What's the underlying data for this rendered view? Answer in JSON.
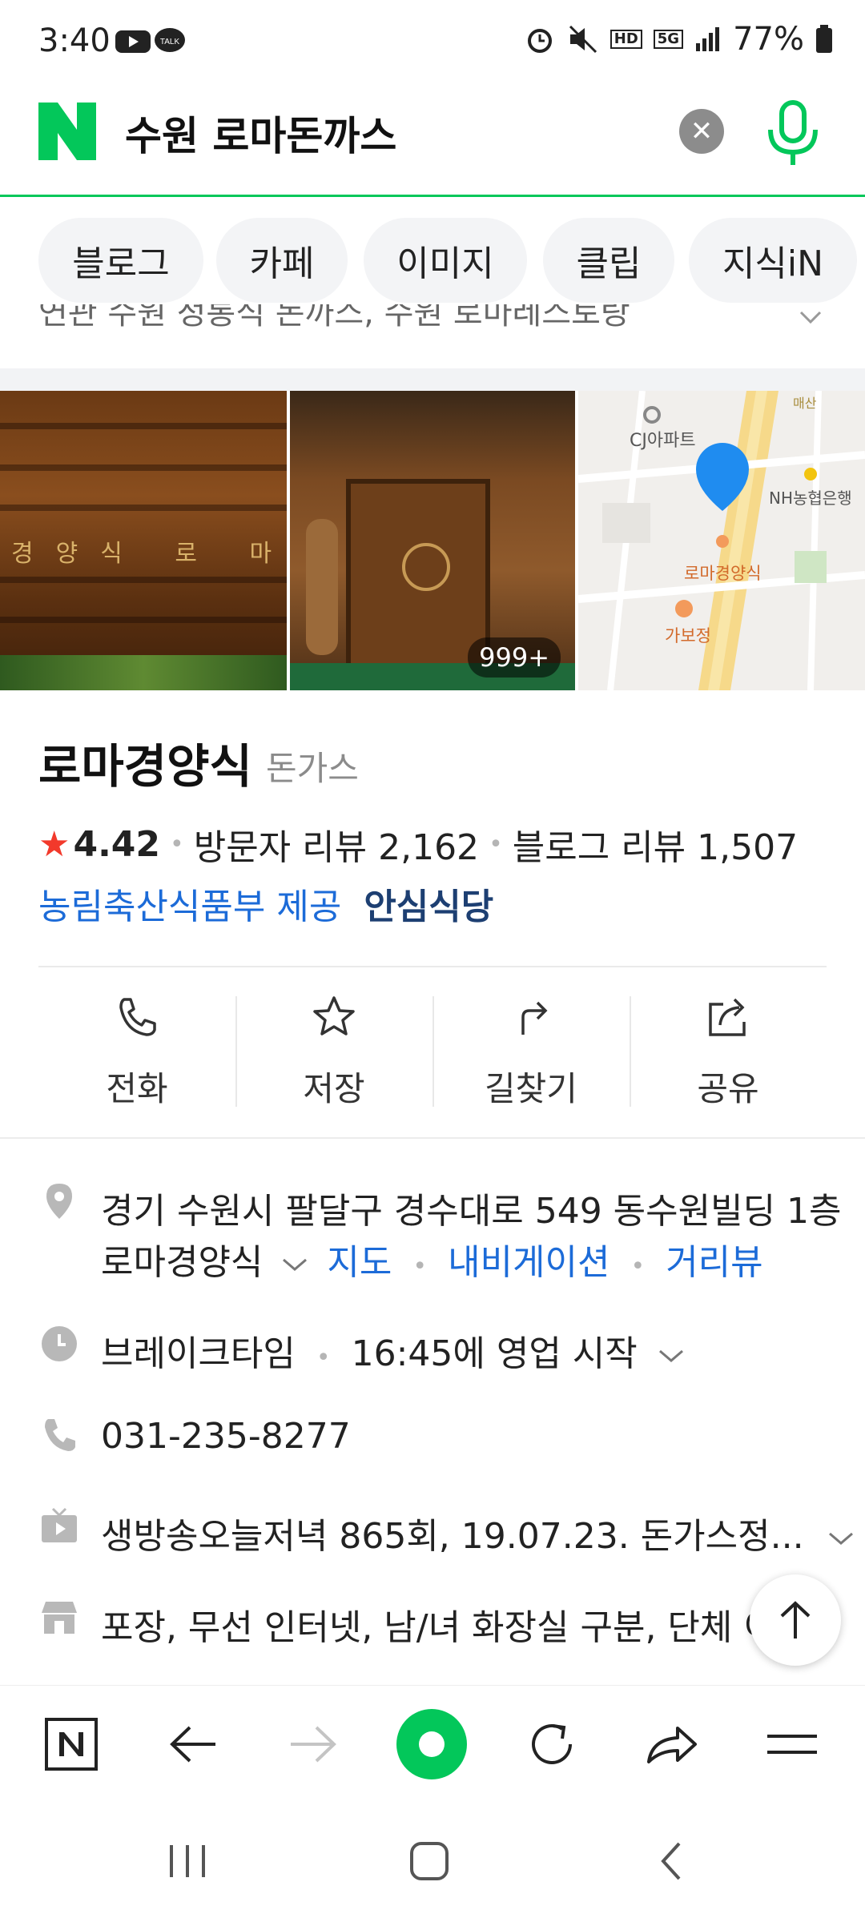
{
  "status_bar": {
    "time": "3:40",
    "battery": "77%",
    "hd_badge": "HD",
    "network": "5G"
  },
  "search": {
    "query": "수원 로마돈까스"
  },
  "tabs": [
    "블로그",
    "카페",
    "이미지",
    "클립",
    "지식iN"
  ],
  "related": {
    "text": "연관  수원 정통식 돈까스, 수원 로마레스토랑"
  },
  "photos": {
    "sign_text": "경양식 로 마",
    "count": "999+",
    "map_labels": {
      "apt": "CJ아파트",
      "bank": "NH농협은행",
      "place": "로마경양식",
      "nearby": "가보정",
      "road": "매산"
    }
  },
  "place": {
    "name": "로마경양식",
    "category": "돈가스",
    "rating": "4.42",
    "visitor_reviews": "방문자 리뷰 2,162",
    "blog_reviews": "블로그 리뷰 1,507",
    "provider": "농림축산식품부 제공",
    "badge": "안심식당"
  },
  "actions": [
    {
      "label": "전화",
      "icon": "phone-icon"
    },
    {
      "label": "저장",
      "icon": "star-icon"
    },
    {
      "label": "길찾기",
      "icon": "directions-icon"
    },
    {
      "label": "공유",
      "icon": "share-icon"
    }
  ],
  "info": {
    "address_line1": "경기 수원시 팔달구 경수대로 549 동수원빌딩 1층",
    "address_name": "로마경양식",
    "map_link": "지도",
    "navi_link": "내비게이션",
    "street_link": "거리뷰",
    "hours_status": "브레이크타임",
    "hours_detail": "16:45에 영업 시작",
    "phone": "031-235-8277",
    "tv": "생방송오늘저녁 865회, 19.07.23. 돈가스정...",
    "amenities": "포장, 무선 인터넷, 남/녀 화장실 구분, 단체 이용"
  },
  "colors": {
    "naver_green": "#03c75a",
    "link_blue": "#1c6bd8",
    "star_red": "#f2392b",
    "badge_navy": "#1d3f72"
  }
}
